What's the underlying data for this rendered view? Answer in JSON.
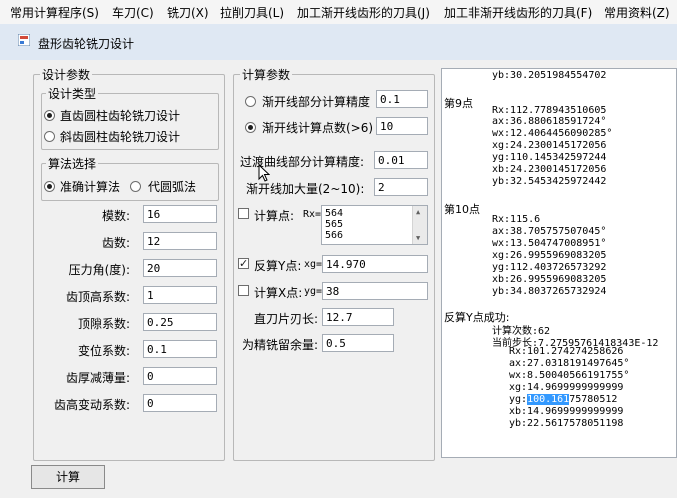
{
  "menu": [
    "常用计算程序(S)",
    "车刀(C)",
    "铣刀(X)",
    "拉削刀具(L)",
    "加工渐开线齿形的刀具(J)",
    "加工非渐开线齿形的刀具(F)",
    "常用资料(Z)"
  ],
  "window_title": "盘形齿轮铣刀设计",
  "design": {
    "group_title": "设计参数",
    "type_group": "设计类型",
    "type_options": [
      "直齿圆柱齿轮铣刀设计",
      "斜齿圆柱齿轮铣刀设计"
    ],
    "algo_group": "算法选择",
    "algo_options": [
      "准确计算法",
      "代圆弧法"
    ],
    "fields": [
      {
        "label": "模数:",
        "value": "16"
      },
      {
        "label": "齿数:",
        "value": "12"
      },
      {
        "label": "压力角(度):",
        "value": "20"
      },
      {
        "label": "齿顶高系数:",
        "value": "1"
      },
      {
        "label": "顶隙系数:",
        "value": "0.25"
      },
      {
        "label": "变位系数:",
        "value": "0.1"
      },
      {
        "label": "齿厚减薄量:",
        "value": "0"
      },
      {
        "label": "齿高变动系数:",
        "value": "0"
      }
    ]
  },
  "calc": {
    "group_title": "计算参数",
    "opt1_label": "渐开线部分计算精度",
    "opt1_value": "0.1",
    "opt2_label": "渐开线计算点数(>6)",
    "opt2_value": "10",
    "trans_label": "过渡曲线部分计算精度:",
    "trans_value": "0.01",
    "extra_label": "渐开线加大量(2~10):",
    "extra_value": "2",
    "pt_label": "计算点:",
    "rx_label": "Rx=",
    "pt_list": [
      "564",
      "565",
      "566"
    ],
    "inv_y_label": "反算Y点:",
    "inv_y_sub": "xg=",
    "inv_y_value": "14.970",
    "inv_x_label": "计算X点:",
    "inv_x_sub": "yg=",
    "inv_x_value": "38",
    "blade_label": "直刀片刃长:",
    "blade_value": "12.7",
    "finish_label": "为精铣留余量:",
    "finish_value": "0.5"
  },
  "output": {
    "top_line": "yb:30.2051984554702",
    "p9_title": "第9点",
    "p9": [
      "Rx:112.778943510605",
      "ax:36.880618591724°",
      "wx:12.4064456090285°",
      "xg:24.2300145172056",
      "yg:110.145342597244",
      "xb:24.2300145172056",
      "yb:32.5453425972442"
    ],
    "p10_title": "第10点",
    "p10": [
      "Rx:115.6",
      "ax:38.705757507045°",
      "wx:13.504747008951°",
      "xg:26.9955969083205",
      "yg:112.403726573292",
      "xb:26.9955969083205",
      "yb:34.8037265732924"
    ],
    "inv_title": "反算Y点成功:",
    "inv_a": [
      "计算次数:62",
      "当前步长:7.27595761418343E-12"
    ],
    "inv_b": [
      "Rx:101.274274258626",
      "ax:27.0318191497645°",
      "wx:8.50040566191755°",
      "xg:14.9699999999999"
    ],
    "yg_prefix": "yg:",
    "yg_sel": "100.161",
    "yg_rest": "75780512",
    "inv_c": [
      "xb:14.9699999999999",
      "yb:22.5617578051198"
    ]
  },
  "calc_button": "计算"
}
